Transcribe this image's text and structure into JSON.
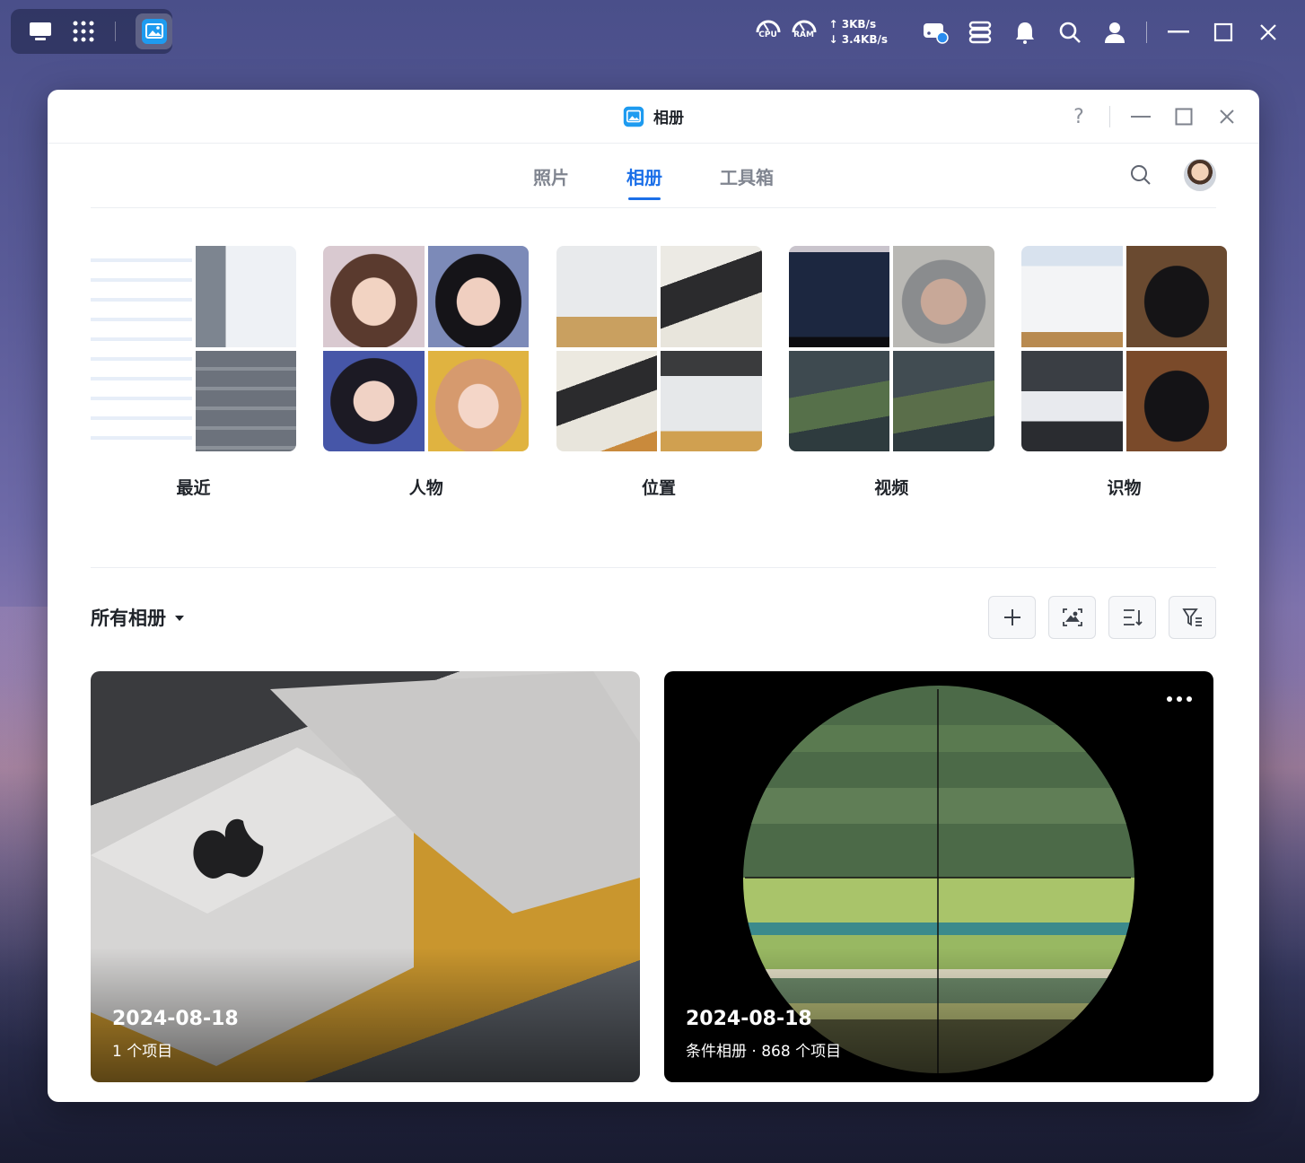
{
  "system": {
    "cpu_label": "CPU",
    "ram_label": "RAM",
    "net_up": "↑ 3KB/s",
    "net_down": "↓ 3.4KB/s"
  },
  "window": {
    "title": "相册",
    "help": "?"
  },
  "tabs": [
    {
      "label": "照片",
      "active": false
    },
    {
      "label": "相册",
      "active": true
    },
    {
      "label": "工具箱",
      "active": false
    }
  ],
  "categories": [
    {
      "label": "最近"
    },
    {
      "label": "人物"
    },
    {
      "label": "位置"
    },
    {
      "label": "视频"
    },
    {
      "label": "识物"
    }
  ],
  "albums_header": {
    "title": "所有相册"
  },
  "albums": [
    {
      "date": "2024-08-18",
      "subtitle": "1 个项目"
    },
    {
      "date": "2024-08-18",
      "subtitle": "条件相册 · 868 个项目"
    }
  ],
  "colors": {
    "accent": "#1b6fe8",
    "tab_inactive": "#808590"
  }
}
